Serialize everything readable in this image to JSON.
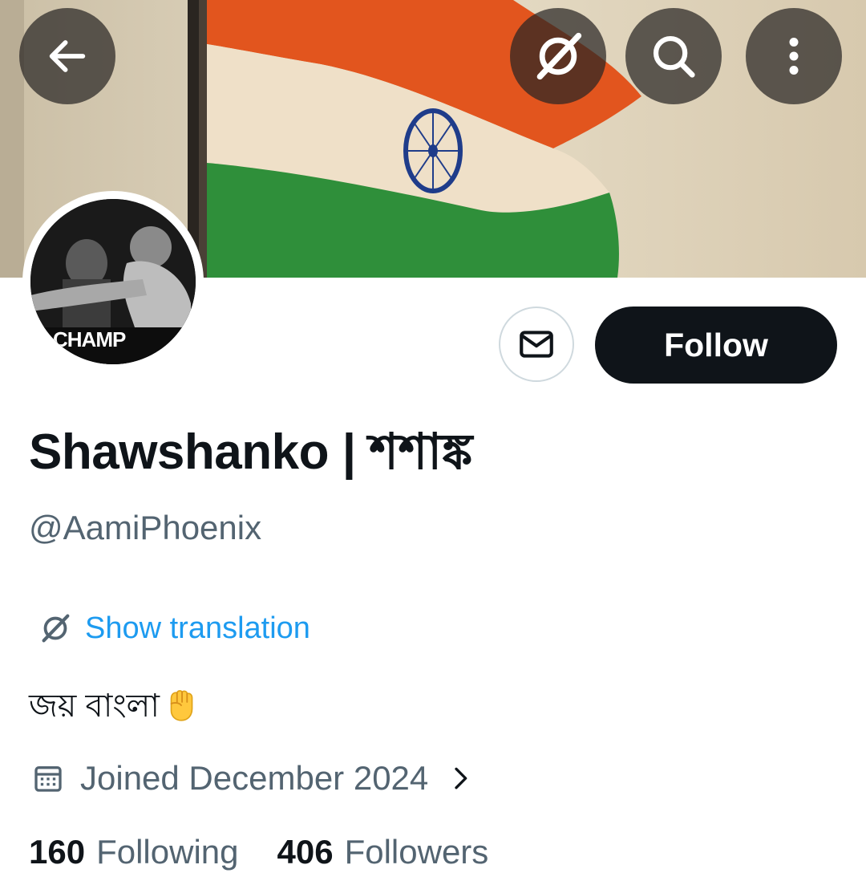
{
  "profile": {
    "display_name": "Shawshanko | শশাঙ্ক",
    "handle": "@AamiPhoenix",
    "translate_label": "Show translation",
    "bio": "জয় বাংলা",
    "joined": "Joined December 2024",
    "following_count": "160",
    "following_label": "Following",
    "followers_count": "406",
    "followers_label": "Followers",
    "avatar_text": "CHAMP"
  },
  "actions": {
    "follow_label": "Follow"
  },
  "icons": {
    "back": "arrow-left-icon",
    "grok": "grok-icon",
    "search": "search-icon",
    "more": "more-vertical-icon",
    "message": "envelope-icon",
    "translate": "translate-icon",
    "calendar": "calendar-icon",
    "chevron": "chevron-right-icon",
    "bio_emoji": "raised-fist-emoji"
  },
  "colors": {
    "accent": "#1d9bf0",
    "text_primary": "#0f1419",
    "text_secondary": "#536471",
    "follow_bg": "#0f1419"
  }
}
